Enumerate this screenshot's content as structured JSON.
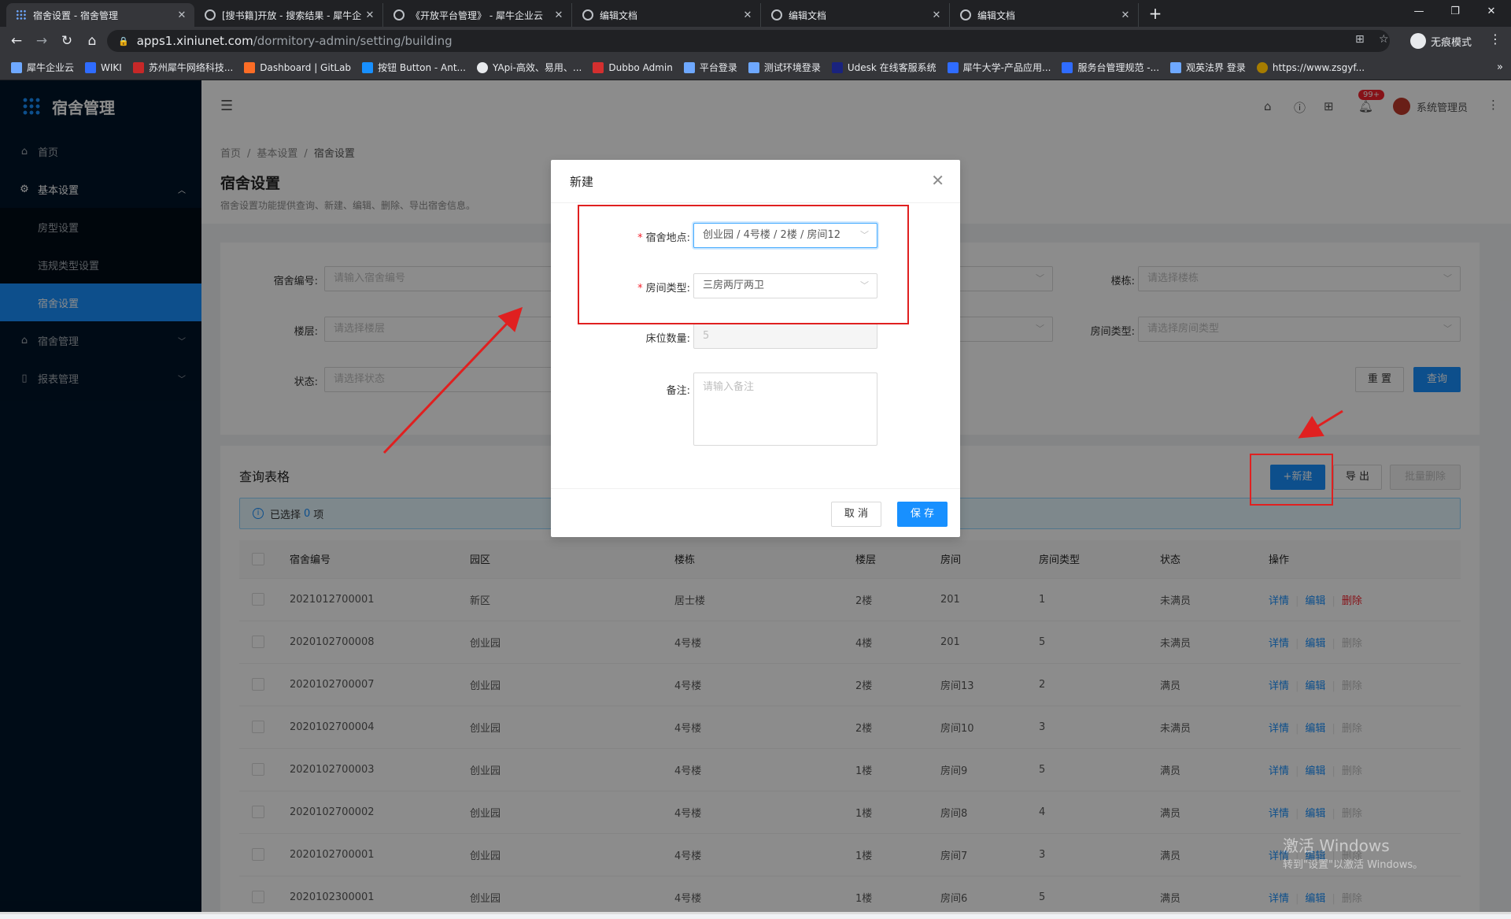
{
  "browser": {
    "tabs": [
      {
        "title": "宿舍设置 - 宿舍管理",
        "active": true
      },
      {
        "title": "[搜书籍]开放 - 搜索结果 - 犀牛企"
      },
      {
        "title": "《开放平台管理》 - 犀牛企业云"
      },
      {
        "title": "编辑文档"
      },
      {
        "title": "编辑文档"
      },
      {
        "title": "编辑文档"
      }
    ],
    "url_host": "apps1.xiniunet.com",
    "url_path": "/dormitory-admin/setting/building",
    "incognito_label": "无痕模式",
    "bookmarks": [
      "犀牛企业云",
      "WIKI",
      "苏州犀牛网络科技...",
      "Dashboard | GitLab",
      "按钮 Button - Ant...",
      "YApi-高效、易用、...",
      "Dubbo Admin",
      "平台登录",
      "测试环境登录",
      "Udesk 在线客服系统",
      "犀牛大学-产品应用...",
      "服务台管理规范 -...",
      "观英法界 登录",
      "https://www.zsgyf..."
    ]
  },
  "sidebar": {
    "app_name": "宿舍管理",
    "items": [
      {
        "label": "首页"
      },
      {
        "label": "基本设置",
        "expanded": true
      },
      {
        "label": "房型设置"
      },
      {
        "label": "违规类型设置"
      },
      {
        "label": "宿舍设置",
        "selected": true
      },
      {
        "label": "宿舍管理"
      },
      {
        "label": "报表管理"
      }
    ]
  },
  "header": {
    "badge": "99+",
    "user": "系统管理员"
  },
  "page": {
    "breadcrumb": [
      "首页",
      "基本设置",
      "宿舍设置"
    ],
    "title": "宿舍设置",
    "desc": "宿舍设置功能提供查询、新建、编辑、删除、导出宿舍信息。"
  },
  "search": {
    "dorm_no_label": "宿舍编号:",
    "dorm_no_placeholder": "请输入宿舍编号",
    "building_label": "楼栋:",
    "building_placeholder": "请选择楼栋",
    "floor_label": "楼层:",
    "floor_placeholder": "请选择楼层",
    "room_type_label": "房间类型:",
    "room_type_placeholder": "请选择房间类型",
    "status_label": "状态:",
    "status_placeholder": "请选择状态",
    "reset": "重 置",
    "query": "查询"
  },
  "table": {
    "title": "查询表格",
    "new_btn": "+新建",
    "export_btn": "导 出",
    "batch_delete_btn": "批量删除",
    "selected_prefix": "已选择",
    "selected_count": "0",
    "selected_suffix": "项",
    "columns": [
      "宿舍编号",
      "园区",
      "楼栋",
      "楼层",
      "房间",
      "房间类型",
      "状态",
      "操作"
    ],
    "ops": {
      "detail": "详情",
      "edit": "编辑",
      "delete": "删除"
    },
    "rows": [
      [
        "2021012700001",
        "新区",
        "居士楼",
        "2楼",
        "201",
        "1",
        "未满员"
      ],
      [
        "2020102700008",
        "创业园",
        "4号楼",
        "4楼",
        "201",
        "5",
        "未满员"
      ],
      [
        "2020102700007",
        "创业园",
        "4号楼",
        "2楼",
        "房间13",
        "2",
        "满员"
      ],
      [
        "2020102700004",
        "创业园",
        "4号楼",
        "2楼",
        "房间10",
        "3",
        "未满员"
      ],
      [
        "2020102700003",
        "创业园",
        "4号楼",
        "1楼",
        "房间9",
        "5",
        "满员"
      ],
      [
        "2020102700002",
        "创业园",
        "4号楼",
        "1楼",
        "房间8",
        "4",
        "满员"
      ],
      [
        "2020102700001",
        "创业园",
        "4号楼",
        "1楼",
        "房间7",
        "3",
        "满员"
      ],
      [
        "2020102300001",
        "创业园",
        "4号楼",
        "1楼",
        "房间6",
        "5",
        "满员"
      ]
    ]
  },
  "modal": {
    "title": "新建",
    "location_label": "宿舍地点:",
    "location_value": "创业园 / 4号楼 / 2楼 / 房间12",
    "room_type_label": "房间类型:",
    "room_type_value": "三房两厅两卫",
    "beds_label": "床位数量:",
    "beds_value": "5",
    "remark_label": "备注:",
    "remark_placeholder": "请输入备注",
    "cancel": "取 消",
    "save": "保 存"
  },
  "watermark": {
    "line1": "激活 Windows",
    "line2": "转到\"设置\"以激活 Windows。"
  },
  "colors": {
    "primary": "#1890ff",
    "sidebar": "#001529",
    "annotation": "#e02020"
  }
}
